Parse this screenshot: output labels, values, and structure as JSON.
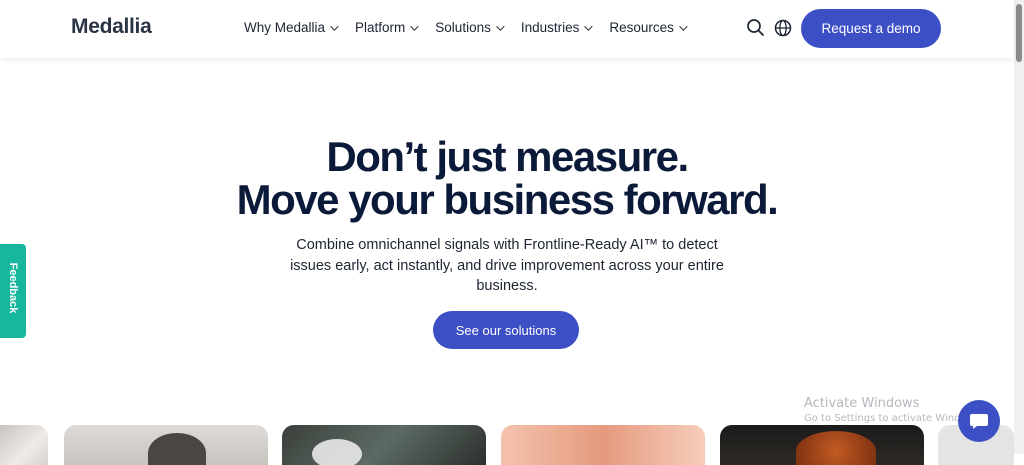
{
  "header": {
    "logo": "Medallia",
    "nav": [
      {
        "label": "Why Medallia"
      },
      {
        "label": "Platform"
      },
      {
        "label": "Solutions"
      },
      {
        "label": "Industries"
      },
      {
        "label": "Resources"
      }
    ],
    "demo_button": "Request a demo",
    "search_icon": "search-icon",
    "globe_icon": "globe-icon"
  },
  "hero": {
    "title_line1": "Don’t just measure.",
    "title_line2": "Move your business forward.",
    "subtitle": "Combine omnichannel signals with Frontline-Ready AI™ to detect issues early, act instantly, and drive improvement across your entire business.",
    "cta": "See our solutions"
  },
  "feedback_tab": "Feedback",
  "watermark": {
    "line1": "Activate Windows",
    "line2": "Go to Settings to activate Windows."
  },
  "colors": {
    "accent": "#3d4fc4",
    "feedback": "#17b79e",
    "heading": "#0c1a3a"
  }
}
